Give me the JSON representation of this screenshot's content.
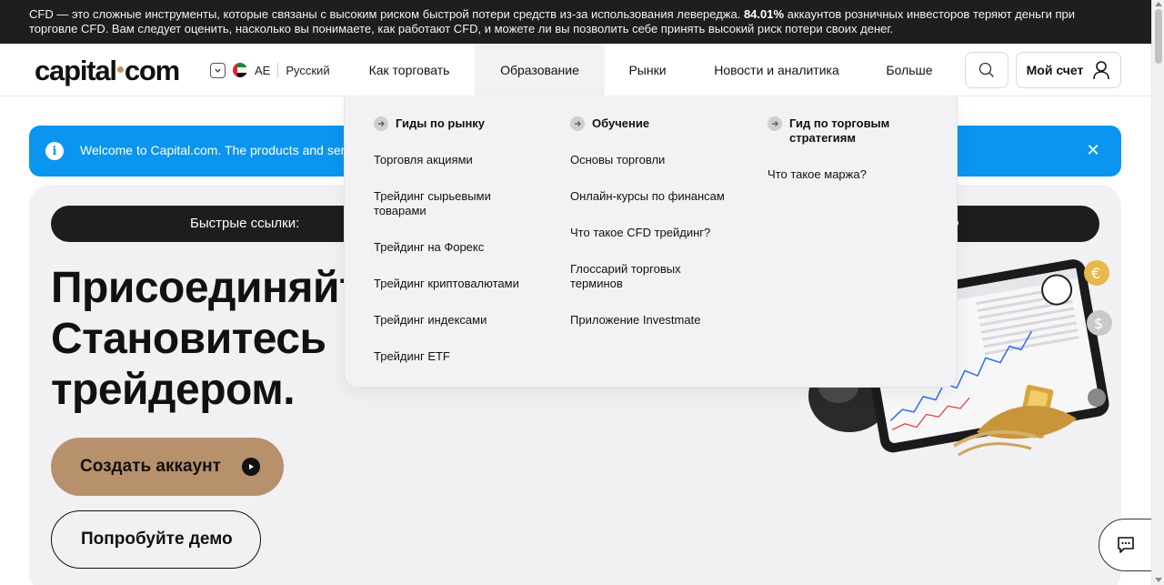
{
  "risk_warning": {
    "part1": "CFD — это сложные инструменты, которые связаны с высоким риском быстрой потери средств из-за использования левереджа. ",
    "percent": "84.01%",
    "part2": " аккаунтов розничных инвесторов теряют деньги при торговле CFD. Вам следует оценить, насколько вы понимаете, как работают CFD, и можете ли вы позволить себе принять высокий риск потери своих денег."
  },
  "header": {
    "logo_left": "capital",
    "logo_right": "com",
    "region_code": "AE",
    "language": "Русский",
    "nav": [
      {
        "label": "Как торговать"
      },
      {
        "label": "Образование"
      },
      {
        "label": "Рынки"
      },
      {
        "label": "Новости и аналитика"
      },
      {
        "label": "Больше"
      }
    ],
    "account_label": "Мой счет",
    "icons": {
      "search": "search-icon",
      "user": "user-icon",
      "flag": "uae-flag-icon"
    }
  },
  "banner": {
    "text": "Welcome to Capital.com. The products and servi",
    "color": "#0a95f0"
  },
  "hero": {
    "quicklinks_label": "Быстрые ссылки:",
    "title_line1": "Присоединяйт",
    "title_line2": "Становитесь",
    "title_line3": "трейдером.",
    "cta_primary": "Создать аккаунт",
    "cta_secondary": "Попробуйте демо",
    "accent": "#b7916c"
  },
  "mega_menu": {
    "columns": [
      {
        "title": "Гиды по рынку",
        "links": [
          "Торговля акциями",
          "Трейдинг сырьевыми товарами",
          "Трейдинг на Форекс",
          "Трейдинг криптовалютами",
          "Трейдинг индексами",
          "Трейдинг ETF"
        ]
      },
      {
        "title": "Обучение",
        "links": [
          "Основы торговли",
          "Онлайн-курсы по финансам",
          "Что такое CFD трейдинг?",
          "Глоссарий торговых терминов",
          "Приложение Investmate"
        ]
      },
      {
        "title": "Гид по торговым стратегиям",
        "links": [
          "Что такое маржа?"
        ]
      }
    ]
  }
}
